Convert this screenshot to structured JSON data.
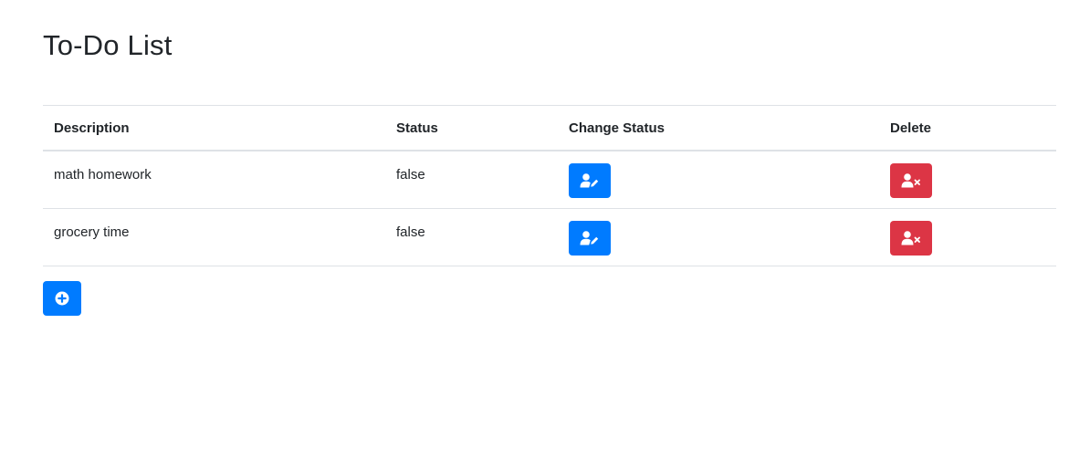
{
  "page": {
    "title": "To-Do List"
  },
  "table": {
    "headers": {
      "description": "Description",
      "status": "Status",
      "change_status": "Change Status",
      "delete": "Delete"
    },
    "rows": [
      {
        "description": "math homework",
        "status": "false"
      },
      {
        "description": "grocery time",
        "status": "false"
      }
    ]
  },
  "icons": {
    "change_status": "user-edit-icon",
    "delete": "user-times-icon",
    "add": "plus-circle-icon"
  },
  "colors": {
    "primary": "#007bff",
    "danger": "#dc3545"
  }
}
